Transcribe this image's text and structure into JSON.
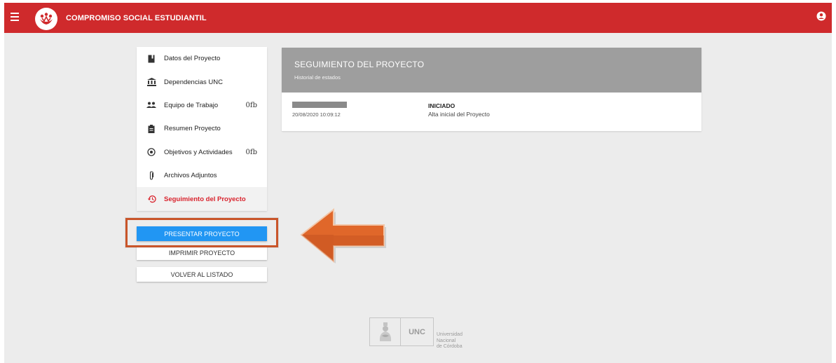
{
  "header": {
    "title": "COMPROMISO SOCIAL ESTUDIANTIL",
    "menu_icon": "hamburger-icon",
    "user_icon": "account-circle-icon",
    "brand_color": "#cf2a2c"
  },
  "sidebar": {
    "items": [
      {
        "label": "Datos del Proyecto",
        "icon": "book-icon",
        "count": ""
      },
      {
        "label": "Dependencias UNC",
        "icon": "institution-icon",
        "count": ""
      },
      {
        "label": "Equipo de Trabajo",
        "icon": "group-icon",
        "count": "0fb"
      },
      {
        "label": "Resumen Proyecto",
        "icon": "clipboard-icon",
        "count": ""
      },
      {
        "label": "Objetivos y Actividades",
        "icon": "target-icon",
        "count": "0fb"
      },
      {
        "label": "Archivos Adjuntos",
        "icon": "paperclip-icon",
        "count": ""
      },
      {
        "label": "Seguimiento del Proyecto",
        "icon": "history-icon",
        "count": "",
        "active": true
      }
    ],
    "active_color": "#d9232d"
  },
  "actions": {
    "present_label": "PRESENTAR PROYECTO",
    "print_label": "IMPRIMIR PROYECTO",
    "back_label": "VOLVER AL LISTADO",
    "primary_color": "#2196f3"
  },
  "annotation": {
    "arrow_color": "#e0672a",
    "box_color": "#c9552a"
  },
  "tracking": {
    "title": "SEGUIMIENTO DEL PROYECTO",
    "subtitle": "Historial de estados",
    "entries": [
      {
        "date": "20/08/2020 10:09:12",
        "state": "INICIADO",
        "description": "Alta inicial del Proyecto"
      }
    ]
  },
  "footer": {
    "logo_text": "UNC",
    "university_lines": [
      "Universidad",
      "Nacional",
      "de Córdoba"
    ]
  }
}
